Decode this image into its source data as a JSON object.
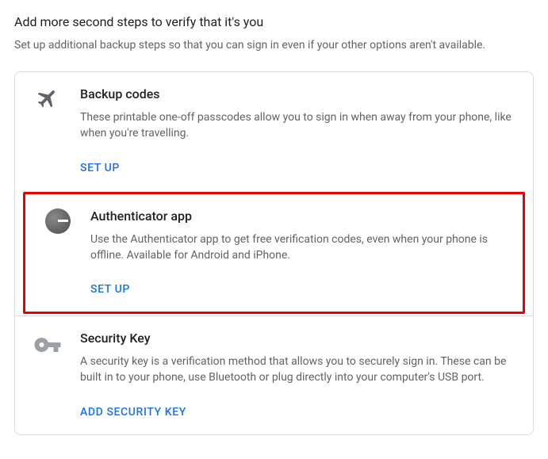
{
  "header": {
    "title": "Add more second steps to verify that it's you",
    "subtitle": "Set up additional backup steps so that you can sign in even if your other options aren't available."
  },
  "options": [
    {
      "title": "Backup codes",
      "description": "These printable one-off passcodes allow you to sign in when away from your phone, like when you're travelling.",
      "action": "SET UP",
      "icon": "plane-icon",
      "highlighted": false
    },
    {
      "title": "Authenticator app",
      "description": "Use the Authenticator app to get free verification codes, even when your phone is offline. Available for Android and iPhone.",
      "action": "SET UP",
      "icon": "authenticator-icon",
      "highlighted": true
    },
    {
      "title": "Security Key",
      "description": "A security key is a verification method that allows you to securely sign in. These can be built in to your phone, use Bluetooth or plug directly into your computer's USB port.",
      "action": "ADD SECURITY KEY",
      "icon": "key-icon",
      "highlighted": false
    }
  ]
}
